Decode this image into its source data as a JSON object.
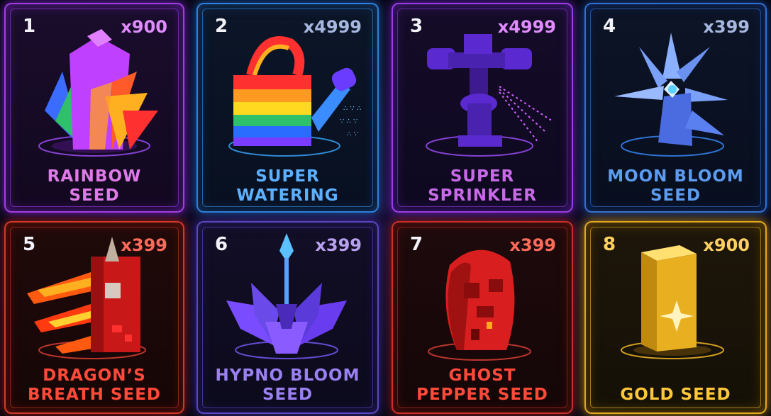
{
  "items": [
    {
      "number": "1",
      "quantity": "x900",
      "name_line1": "RAINBOW",
      "name_line2": "SEED",
      "icon": "rainbow-crystal-icon"
    },
    {
      "number": "2",
      "quantity": "x4999",
      "name_line1": "SUPER",
      "name_line2": "WATERING",
      "icon": "watering-can-icon"
    },
    {
      "number": "3",
      "quantity": "x4999",
      "name_line1": "SUPER",
      "name_line2": "SPRINKLER",
      "icon": "sprinkler-icon"
    },
    {
      "number": "4",
      "quantity": "x399",
      "name_line1": "MOON BLOOM",
      "name_line2": "SEED",
      "icon": "moon-bloom-flower-icon"
    },
    {
      "number": "5",
      "quantity": "x399",
      "name_line1": "DRAGON’S",
      "name_line2": "BREATH SEED",
      "icon": "dragon-breath-icon"
    },
    {
      "number": "6",
      "quantity": "x399",
      "name_line1": "HYPNO BLOOM",
      "name_line2": "SEED",
      "icon": "hypno-bloom-crystal-icon"
    },
    {
      "number": "7",
      "quantity": "x399",
      "name_line1": "GHOST",
      "name_line2": "PEPPER SEED",
      "icon": "ghost-pepper-icon"
    },
    {
      "number": "8",
      "quantity": "x900",
      "name_line1": "",
      "name_line2": "GOLD SEED",
      "icon": "gold-bar-icon"
    }
  ],
  "theme": {
    "background": "#0b0a1c",
    "card1_accent": "#c25cff",
    "card2_accent": "#3aa8ff",
    "card3_accent": "#a64dff",
    "card4_accent": "#5aa6ff",
    "card5_accent": "#ff3a2a",
    "card6_accent": "#8a5cff",
    "card7_accent": "#ff3a3a",
    "card8_accent": "#ffc62e"
  }
}
